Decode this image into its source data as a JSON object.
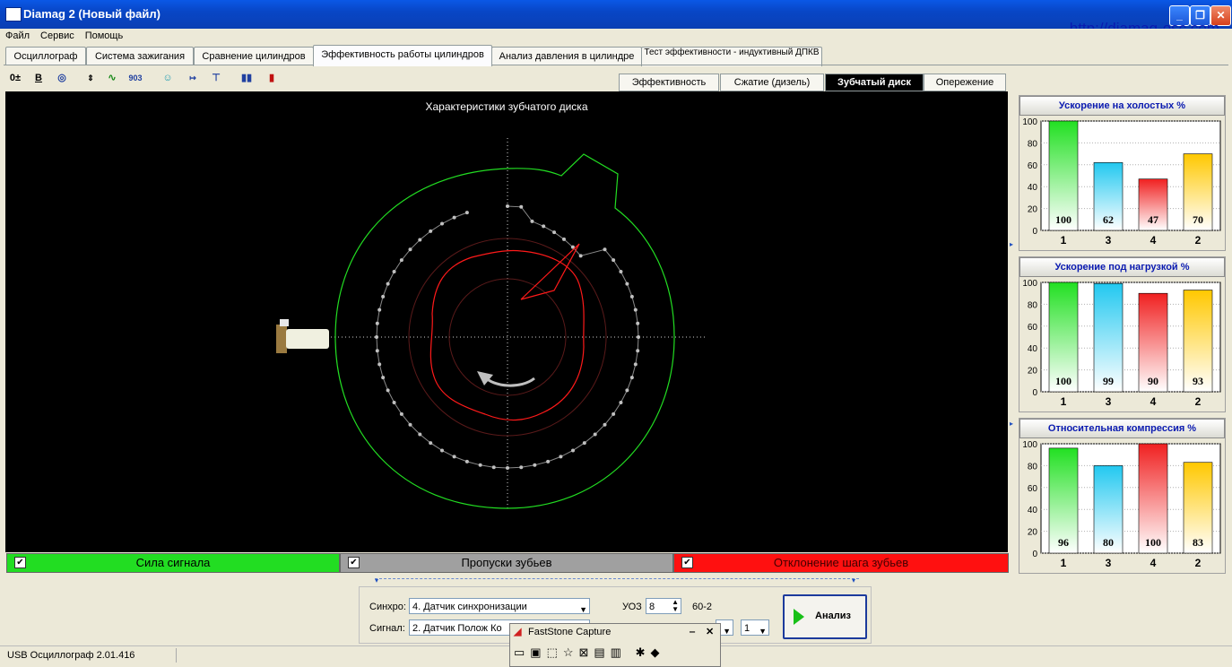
{
  "window": {
    "title": "Diamag 2 (Новый файл)",
    "url_text": "http://diamag-osc.com"
  },
  "menu": [
    "Файл",
    "Сервис",
    "Помощь"
  ],
  "tabs": [
    {
      "label": "Осциллограф"
    },
    {
      "label": "Система зажигания"
    },
    {
      "label": "Сравнение цилиндров"
    },
    {
      "label": "Эффективность работы цилиндров",
      "active": true
    },
    {
      "label": "Анализ давления в цилиндре"
    },
    {
      "label": "Тест эффективности - индуктивный ДПКВ"
    }
  ],
  "subtabs": [
    {
      "label": "Эффективность"
    },
    {
      "label": "Сжатие (дизель)"
    },
    {
      "label": "Зубчатый диск",
      "active": true
    },
    {
      "label": "Опережение"
    }
  ],
  "toolbar_icons": [
    "zoom-icon",
    "bold-icon",
    "rpm-icon",
    "scale-icon",
    "trend-icon",
    "903-icon",
    "person-icon",
    "count-icon",
    "filter-icon",
    "cylinders-chart-icon",
    "level-icon"
  ],
  "plot": {
    "title": "Характеристики зубчатого диска"
  },
  "legend": [
    {
      "label": "Сила сигнала",
      "color": "#22dd22",
      "text_color": "#000000"
    },
    {
      "label": "Пропуски зубьев",
      "color": "#a0a0a0",
      "text_color": "#000000"
    },
    {
      "label": "Отклонение шага зубьев",
      "color": "#ff1010",
      "text_color": "#400000"
    }
  ],
  "charts": [
    {
      "title": "Ускорение на холостых %",
      "ylim": [
        0,
        100
      ],
      "yticks": [
        "100",
        "80",
        "60",
        "40",
        "20",
        "0"
      ],
      "categories": [
        "1",
        "3",
        "4",
        "2"
      ],
      "values": [
        100,
        62,
        47,
        70
      ],
      "show_labels": true
    },
    {
      "title": "Ускорение под нагрузкой %",
      "ylim": [
        0,
        100
      ],
      "yticks": [
        "100",
        "80",
        "60",
        "40",
        "20",
        "0"
      ],
      "categories": [
        "1",
        "3",
        "4",
        "2"
      ],
      "values": [
        100,
        99,
        90,
        93
      ],
      "show_labels": true
    },
    {
      "title": "Относительная компрессия %",
      "ylim": [
        0,
        100
      ],
      "yticks": [
        "100",
        "80",
        "60",
        "40",
        "20",
        "0"
      ],
      "categories": [
        "1",
        "3",
        "4",
        "2"
      ],
      "values": [
        96,
        80,
        100,
        83
      ],
      "show_labels": true
    }
  ],
  "bar_colors": [
    "#22e022",
    "#22c8f0",
    "#f02020",
    "#ffc800"
  ],
  "controls": {
    "sync_label": "Синхро:",
    "sync_value": "4.  Датчик синхронизации",
    "signal_label": "Сигнал:",
    "signal_value": "2.  Датчик Полож Ко",
    "uoz_label": "УОЗ",
    "uoz_value": "8",
    "teeth_value": "60-2",
    "extra_value": "1",
    "analyze_label": "Анализ"
  },
  "status": {
    "text": "USB Осциллограф  2.01.416"
  },
  "faststone": {
    "title": "FastStone Capture"
  }
}
